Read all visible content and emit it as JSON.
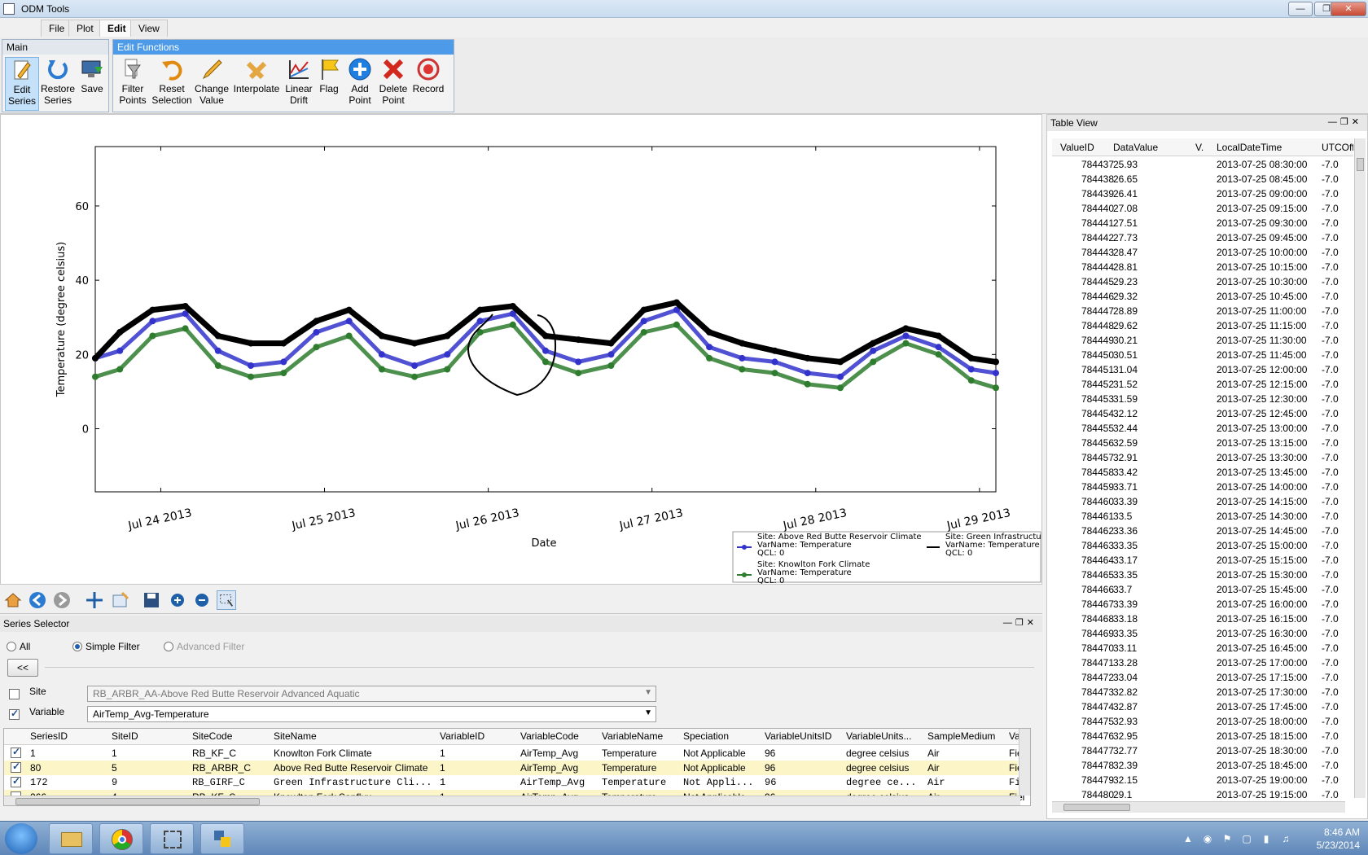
{
  "window": {
    "title": "ODM Tools",
    "controls": [
      "—",
      "❐",
      "✕"
    ]
  },
  "menu": [
    "File",
    "Plot",
    "Edit",
    "View"
  ],
  "ribbon": {
    "main_label": "Main",
    "edit_label": "Edit Functions",
    "main_buttons": [
      {
        "line1": "Edit",
        "line2": "Series",
        "icon": "edit-pencil-icon"
      },
      {
        "line1": "Restore",
        "line2": "Series",
        "icon": "restore-arrow-icon"
      },
      {
        "line1": "Save",
        "line2": "",
        "icon": "save-computer-icon"
      }
    ],
    "edit_buttons": [
      {
        "line1": "Filter",
        "line2": "Points",
        "icon": "filter-funnel-icon"
      },
      {
        "line1": "Reset",
        "line2": "Selection",
        "icon": "reset-arrow-icon"
      },
      {
        "line1": "Change",
        "line2": "Value",
        "icon": "pencil-icon"
      },
      {
        "line1": "Interpolate",
        "line2": "",
        "icon": "interpolate-cross-icon"
      },
      {
        "line1": "Linear",
        "line2": "Drift",
        "icon": "linear-drift-chart-icon"
      },
      {
        "line1": "Flag",
        "line2": "",
        "icon": "flag-icon"
      },
      {
        "line1": "Add",
        "line2": "Point",
        "icon": "add-plus-icon"
      },
      {
        "line1": "Delete",
        "line2": "Point",
        "icon": "delete-x-icon"
      },
      {
        "line1": "Record",
        "line2": "",
        "icon": "record-circle-icon"
      }
    ]
  },
  "plot": {
    "legend": [
      {
        "site": "Site: Above Red Butte Reservoir Climate",
        "var": "VarName: Temperature",
        "qcl": "QCL: 0",
        "color": "#3333cc"
      },
      {
        "site": "Site: Knowlton Fork Climate",
        "var": "VarName: Temperature",
        "qcl": "QCL: 0",
        "color": "#2e7d2e"
      },
      {
        "site": "Site: Green Infrastructure",
        "var": "VarName: Temperature",
        "qcl": "QCL: 0",
        "color": "#000000"
      }
    ]
  },
  "chart_data": {
    "type": "line",
    "xlabel": "Date",
    "ylabel": "Temperature (degree celsius)",
    "x_ticks": [
      "Jul 24 2013",
      "Jul 25 2013",
      "Jul 26 2013",
      "Jul 27 2013",
      "Jul 28 2013",
      "Jul 29 2013"
    ],
    "y_ticks": [
      0,
      20,
      40,
      60
    ],
    "xlim": [
      23.6,
      29.1
    ],
    "ylim": [
      -17,
      76
    ],
    "grid": false,
    "legend_position": "bottom-right",
    "x": [
      23.6,
      23.75,
      23.95,
      24.15,
      24.35,
      24.55,
      24.75,
      24.95,
      25.15,
      25.35,
      25.55,
      25.75,
      25.95,
      26.15,
      26.35,
      26.55,
      26.75,
      26.95,
      27.15,
      27.35,
      27.55,
      27.75,
      27.95,
      28.15,
      28.35,
      28.55,
      28.75,
      28.95,
      29.1
    ],
    "series": [
      {
        "name": "Site: Above Red Butte Reservoir Climate",
        "color": "#3333cc",
        "values": [
          19,
          21,
          29,
          31,
          21,
          17,
          18,
          26,
          29,
          20,
          17,
          20,
          29,
          31,
          21,
          18,
          20,
          29,
          32,
          22,
          19,
          18,
          15,
          14,
          21,
          25,
          22,
          16,
          15
        ]
      },
      {
        "name": "Site: Knowlton Fork Climate",
        "color": "#2e7d2e",
        "values": [
          14,
          16,
          25,
          27,
          17,
          14,
          15,
          22,
          25,
          16,
          14,
          16,
          26,
          28,
          18,
          15,
          17,
          26,
          28,
          19,
          16,
          15,
          12,
          11,
          18,
          23,
          20,
          13,
          11
        ]
      },
      {
        "name": "Site: Green Infrastructure",
        "color": "#000000",
        "values": [
          19,
          26,
          32,
          33,
          25,
          23,
          23,
          29,
          32,
          25,
          23,
          25,
          32,
          33,
          25,
          24,
          23,
          32,
          34,
          26,
          23,
          21,
          19,
          18,
          23,
          27,
          25,
          19,
          18
        ]
      }
    ]
  },
  "plot_toolbar": [
    "home-icon",
    "back-arrow-icon",
    "forward-arrow-icon",
    "pan-cross-icon",
    "configure-subplots-icon",
    "save-figure-icon",
    "zoom-in-icon",
    "zoom-out-icon",
    "select-region-icon"
  ],
  "series_selector": {
    "title": "Series Selector",
    "filters": [
      {
        "label": "All",
        "on": false,
        "disabled": false
      },
      {
        "label": "Simple Filter",
        "on": true,
        "disabled": false
      },
      {
        "label": "Advanced Filter",
        "on": false,
        "disabled": true
      }
    ],
    "collapse_label": "<<",
    "site_label": "Site",
    "site_value": "RB_ARBR_AA-Above Red Butte Reservoir Advanced Aquatic",
    "variable_label": "Variable",
    "variable_value": "AirTemp_Avg-Temperature",
    "columns": [
      "SeriesID",
      "SiteID",
      "SiteCode",
      "SiteName",
      "VariableID",
      "VariableCode",
      "VariableName",
      "Speciation",
      "VariableUnitsID",
      "VariableUnits...",
      "SampleMedium",
      "Val"
    ],
    "rows": [
      {
        "checked": true,
        "cells": [
          "1",
          "1",
          "RB_KF_C",
          "Knowlton Fork Climate",
          "1",
          "AirTemp_Avg",
          "Temperature",
          "Not Applicable",
          "96",
          "degree celsius",
          "Air",
          "Fiel"
        ]
      },
      {
        "checked": true,
        "cells": [
          "80",
          "5",
          "RB_ARBR_C",
          "Above Red Butte Reservoir Climate",
          "1",
          "AirTemp_Avg",
          "Temperature",
          "Not Applicable",
          "96",
          "degree celsius",
          "Air",
          "Fiel"
        ]
      },
      {
        "checked": true,
        "cells": [
          "172",
          "9",
          "RB_GIRF_C",
          "Green Infrastructure Cli...",
          "1",
          "AirTemp_Avg",
          "Temperature",
          "Not Appli...",
          "96",
          "degree ce...",
          "Air",
          "Fiel"
        ]
      },
      {
        "checked": false,
        "cells": [
          "266",
          "4",
          "RB_KF_S",
          "Knowlton Fork Sapflux",
          "1",
          "AirTemp_Avg",
          "Temperature",
          "Not Applicable",
          "96",
          "degree celsius",
          "Air",
          "Fiel"
        ]
      }
    ]
  },
  "table_view": {
    "title": "Table View",
    "columns": [
      "ValueID",
      "DataValue",
      "V.",
      "LocalDateTime",
      "UTCOff"
    ],
    "rows": [
      [
        "784437",
        "25.93",
        "2013-07-25 08:30:00",
        "-7.0"
      ],
      [
        "784438",
        "26.65",
        "2013-07-25 08:45:00",
        "-7.0"
      ],
      [
        "784439",
        "26.41",
        "2013-07-25 09:00:00",
        "-7.0"
      ],
      [
        "784440",
        "27.08",
        "2013-07-25 09:15:00",
        "-7.0"
      ],
      [
        "784441",
        "27.51",
        "2013-07-25 09:30:00",
        "-7.0"
      ],
      [
        "784442",
        "27.73",
        "2013-07-25 09:45:00",
        "-7.0"
      ],
      [
        "784443",
        "28.47",
        "2013-07-25 10:00:00",
        "-7.0"
      ],
      [
        "784444",
        "28.81",
        "2013-07-25 10:15:00",
        "-7.0"
      ],
      [
        "784445",
        "29.23",
        "2013-07-25 10:30:00",
        "-7.0"
      ],
      [
        "784446",
        "29.32",
        "2013-07-25 10:45:00",
        "-7.0"
      ],
      [
        "784447",
        "28.89",
        "2013-07-25 11:00:00",
        "-7.0"
      ],
      [
        "784448",
        "29.62",
        "2013-07-25 11:15:00",
        "-7.0"
      ],
      [
        "784449",
        "30.21",
        "2013-07-25 11:30:00",
        "-7.0"
      ],
      [
        "784450",
        "30.51",
        "2013-07-25 11:45:00",
        "-7.0"
      ],
      [
        "784451",
        "31.04",
        "2013-07-25 12:00:00",
        "-7.0"
      ],
      [
        "784452",
        "31.52",
        "2013-07-25 12:15:00",
        "-7.0"
      ],
      [
        "784453",
        "31.59",
        "2013-07-25 12:30:00",
        "-7.0"
      ],
      [
        "784454",
        "32.12",
        "2013-07-25 12:45:00",
        "-7.0"
      ],
      [
        "784455",
        "32.44",
        "2013-07-25 13:00:00",
        "-7.0"
      ],
      [
        "784456",
        "32.59",
        "2013-07-25 13:15:00",
        "-7.0"
      ],
      [
        "784457",
        "32.91",
        "2013-07-25 13:30:00",
        "-7.0"
      ],
      [
        "784458",
        "33.42",
        "2013-07-25 13:45:00",
        "-7.0"
      ],
      [
        "784459",
        "33.71",
        "2013-07-25 14:00:00",
        "-7.0"
      ],
      [
        "784460",
        "33.39",
        "2013-07-25 14:15:00",
        "-7.0"
      ],
      [
        "784461",
        "33.5",
        "2013-07-25 14:30:00",
        "-7.0"
      ],
      [
        "784462",
        "33.36",
        "2013-07-25 14:45:00",
        "-7.0"
      ],
      [
        "784463",
        "33.35",
        "2013-07-25 15:00:00",
        "-7.0"
      ],
      [
        "784464",
        "33.17",
        "2013-07-25 15:15:00",
        "-7.0"
      ],
      [
        "784465",
        "33.35",
        "2013-07-25 15:30:00",
        "-7.0"
      ],
      [
        "784466",
        "33.7",
        "2013-07-25 15:45:00",
        "-7.0"
      ],
      [
        "784467",
        "33.39",
        "2013-07-25 16:00:00",
        "-7.0"
      ],
      [
        "784468",
        "33.18",
        "2013-07-25 16:15:00",
        "-7.0"
      ],
      [
        "784469",
        "33.35",
        "2013-07-25 16:30:00",
        "-7.0"
      ],
      [
        "784470",
        "33.11",
        "2013-07-25 16:45:00",
        "-7.0"
      ],
      [
        "784471",
        "33.28",
        "2013-07-25 17:00:00",
        "-7.0"
      ],
      [
        "784472",
        "33.04",
        "2013-07-25 17:15:00",
        "-7.0"
      ],
      [
        "784473",
        "32.82",
        "2013-07-25 17:30:00",
        "-7.0"
      ],
      [
        "784474",
        "32.87",
        "2013-07-25 17:45:00",
        "-7.0"
      ],
      [
        "784475",
        "32.93",
        "2013-07-25 18:00:00",
        "-7.0"
      ],
      [
        "784476",
        "32.95",
        "2013-07-25 18:15:00",
        "-7.0"
      ],
      [
        "784477",
        "32.77",
        "2013-07-25 18:30:00",
        "-7.0"
      ],
      [
        "784478",
        "32.39",
        "2013-07-25 18:45:00",
        "-7.0"
      ],
      [
        "784479",
        "32.15",
        "2013-07-25 19:00:00",
        "-7.0"
      ],
      [
        "784480",
        "29.1",
        "2013-07-25 19:15:00",
        "-7.0"
      ]
    ]
  },
  "taskbar": {
    "time": "8:46 AM",
    "date": "5/23/2014",
    "apps": [
      "explorer-folder-icon",
      "chrome-icon",
      "odm-tools-icon",
      "python-icon"
    ]
  }
}
